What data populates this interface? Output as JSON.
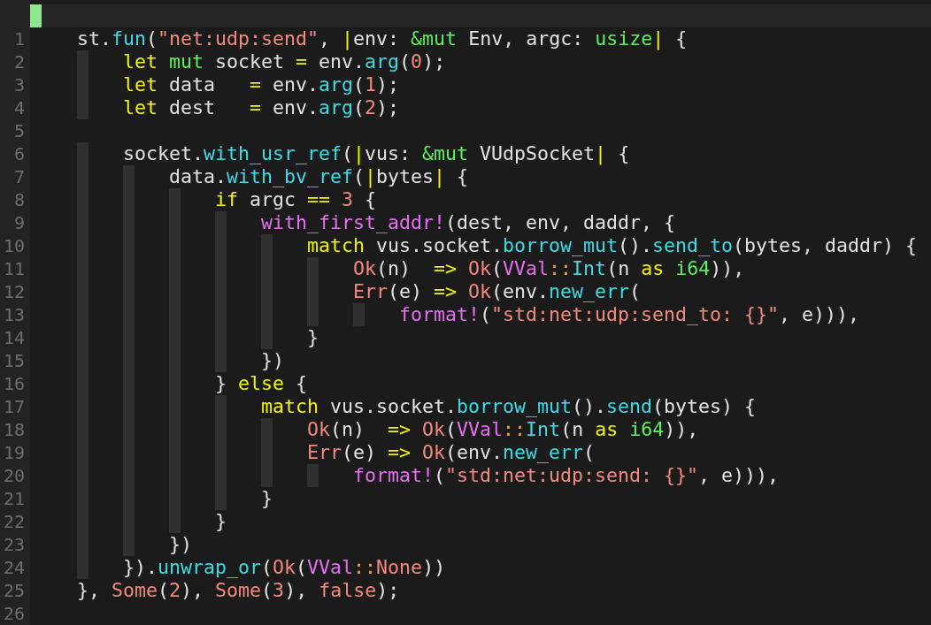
{
  "editor": {
    "lines": [
      {
        "number": "1",
        "tokens": [
          {
            "text": "    st.",
            "kind": "p"
          },
          {
            "text": "fun",
            "kind": "f"
          },
          {
            "text": "(",
            "kind": "p"
          },
          {
            "text": "\"net:udp:send\"",
            "kind": "s"
          },
          {
            "text": ", ",
            "kind": "p"
          },
          {
            "text": "|",
            "kind": "k"
          },
          {
            "text": "env: ",
            "kind": "p"
          },
          {
            "text": "&mut",
            "kind": "t"
          },
          {
            "text": " Env, argc: ",
            "kind": "p"
          },
          {
            "text": "usize",
            "kind": "t"
          },
          {
            "text": "|",
            "kind": "k"
          },
          {
            "text": " {",
            "kind": "p"
          }
        ]
      },
      {
        "number": "2",
        "tokens": [
          {
            "text": "        let ",
            "kind": "k"
          },
          {
            "text": "mut",
            "kind": "t"
          },
          {
            "text": " socket ",
            "kind": "p"
          },
          {
            "text": "=",
            "kind": "k"
          },
          {
            "text": " env.",
            "kind": "p"
          },
          {
            "text": "arg",
            "kind": "f"
          },
          {
            "text": "(",
            "kind": "p"
          },
          {
            "text": "0",
            "kind": "s"
          },
          {
            "text": ");",
            "kind": "p"
          }
        ]
      },
      {
        "number": "3",
        "tokens": [
          {
            "text": "        let",
            "kind": "k"
          },
          {
            "text": " data   ",
            "kind": "p"
          },
          {
            "text": "=",
            "kind": "k"
          },
          {
            "text": " env.",
            "kind": "p"
          },
          {
            "text": "arg",
            "kind": "f"
          },
          {
            "text": "(",
            "kind": "p"
          },
          {
            "text": "1",
            "kind": "s"
          },
          {
            "text": ");",
            "kind": "p"
          }
        ]
      },
      {
        "number": "4",
        "tokens": [
          {
            "text": "        let",
            "kind": "k"
          },
          {
            "text": " dest   ",
            "kind": "p"
          },
          {
            "text": "=",
            "kind": "k"
          },
          {
            "text": " env.",
            "kind": "p"
          },
          {
            "text": "arg",
            "kind": "f"
          },
          {
            "text": "(",
            "kind": "p"
          },
          {
            "text": "2",
            "kind": "s"
          },
          {
            "text": ");",
            "kind": "p"
          }
        ]
      },
      {
        "number": "5"
      },
      {
        "number": "6",
        "tokens": [
          {
            "text": "        socket.",
            "kind": "p"
          },
          {
            "text": "with_usr_ref",
            "kind": "f"
          },
          {
            "text": "(",
            "kind": "p"
          },
          {
            "text": "|",
            "kind": "k"
          },
          {
            "text": "vus: ",
            "kind": "p"
          },
          {
            "text": "&mut",
            "kind": "t"
          },
          {
            "text": " VUdpSocket",
            "kind": "p"
          },
          {
            "text": "|",
            "kind": "k"
          },
          {
            "text": " {",
            "kind": "p"
          }
        ]
      },
      {
        "number": "7",
        "tokens": [
          {
            "text": "            data.",
            "kind": "p"
          },
          {
            "text": "with_bv_ref",
            "kind": "f"
          },
          {
            "text": "(",
            "kind": "p"
          },
          {
            "text": "|",
            "kind": "k"
          },
          {
            "text": "bytes",
            "kind": "p"
          },
          {
            "text": "|",
            "kind": "k"
          },
          {
            "text": " {",
            "kind": "p"
          }
        ]
      },
      {
        "number": "8",
        "tokens": [
          {
            "text": "                if",
            "kind": "k"
          },
          {
            "text": " argc ",
            "kind": "p"
          },
          {
            "text": "== ",
            "kind": "k"
          },
          {
            "text": "3",
            "kind": "s"
          },
          {
            "text": " {",
            "kind": "p"
          }
        ]
      },
      {
        "number": "9",
        "tokens": [
          {
            "text": "                    with_first_addr!",
            "kind": "m"
          },
          {
            "text": "(dest, env, daddr, {",
            "kind": "p"
          }
        ]
      },
      {
        "number": "10",
        "tokens": [
          {
            "text": "                        match",
            "kind": "k"
          },
          {
            "text": " vus.socket.",
            "kind": "p"
          },
          {
            "text": "borrow_mut",
            "kind": "f"
          },
          {
            "text": "().",
            "kind": "p"
          },
          {
            "text": "send_to",
            "kind": "f"
          },
          {
            "text": "(bytes, daddr) {",
            "kind": "p"
          }
        ]
      },
      {
        "number": "11",
        "tokens": [
          {
            "text": "                            Ok",
            "kind": "s"
          },
          {
            "text": "(n)  ",
            "kind": "p"
          },
          {
            "text": "=> ",
            "kind": "k"
          },
          {
            "text": "Ok",
            "kind": "s"
          },
          {
            "text": "(",
            "kind": "p"
          },
          {
            "text": "VVal",
            "kind": "m"
          },
          {
            "text": "::",
            "kind": "o"
          },
          {
            "text": "Int",
            "kind": "f"
          },
          {
            "text": "(n ",
            "kind": "p"
          },
          {
            "text": "as ",
            "kind": "k"
          },
          {
            "text": "i64",
            "kind": "t"
          },
          {
            "text": ")),",
            "kind": "p"
          }
        ]
      },
      {
        "number": "12",
        "tokens": [
          {
            "text": "                            Err",
            "kind": "s"
          },
          {
            "text": "(e) ",
            "kind": "p"
          },
          {
            "text": "=> ",
            "kind": "k"
          },
          {
            "text": "Ok",
            "kind": "s"
          },
          {
            "text": "(env.",
            "kind": "p"
          },
          {
            "text": "new_err",
            "kind": "f"
          },
          {
            "text": "(",
            "kind": "p"
          }
        ]
      },
      {
        "number": "13",
        "tokens": [
          {
            "text": "                                format!",
            "kind": "m"
          },
          {
            "text": "(",
            "kind": "p"
          },
          {
            "text": "\"std:net:udp:send_to: {}\"",
            "kind": "s"
          },
          {
            "text": ", e))),",
            "kind": "p"
          }
        ]
      },
      {
        "number": "14",
        "tokens": [
          {
            "text": "                        }",
            "kind": "p"
          }
        ]
      },
      {
        "number": "15",
        "tokens": [
          {
            "text": "                    })",
            "kind": "p"
          }
        ]
      },
      {
        "number": "16",
        "tokens": [
          {
            "text": "                } ",
            "kind": "p"
          },
          {
            "text": "else",
            "kind": "k"
          },
          {
            "text": " {",
            "kind": "p"
          }
        ]
      },
      {
        "number": "17",
        "tokens": [
          {
            "text": "                    match",
            "kind": "k"
          },
          {
            "text": " vus.socket.",
            "kind": "p"
          },
          {
            "text": "borrow_mut",
            "kind": "f"
          },
          {
            "text": "().",
            "kind": "p"
          },
          {
            "text": "send",
            "kind": "f"
          },
          {
            "text": "(bytes) {",
            "kind": "p"
          }
        ]
      },
      {
        "number": "18",
        "tokens": [
          {
            "text": "                        Ok",
            "kind": "s"
          },
          {
            "text": "(n)  ",
            "kind": "p"
          },
          {
            "text": "=> ",
            "kind": "k"
          },
          {
            "text": "Ok",
            "kind": "s"
          },
          {
            "text": "(",
            "kind": "p"
          },
          {
            "text": "VVal",
            "kind": "m"
          },
          {
            "text": "::",
            "kind": "o"
          },
          {
            "text": "Int",
            "kind": "f"
          },
          {
            "text": "(n ",
            "kind": "p"
          },
          {
            "text": "as ",
            "kind": "k"
          },
          {
            "text": "i64",
            "kind": "t"
          },
          {
            "text": ")),",
            "kind": "p"
          }
        ]
      },
      {
        "number": "19",
        "tokens": [
          {
            "text": "                        Err",
            "kind": "s"
          },
          {
            "text": "(e) ",
            "kind": "p"
          },
          {
            "text": "=> ",
            "kind": "k"
          },
          {
            "text": "Ok",
            "kind": "s"
          },
          {
            "text": "(env.",
            "kind": "p"
          },
          {
            "text": "new_err",
            "kind": "f"
          },
          {
            "text": "(",
            "kind": "p"
          }
        ]
      },
      {
        "number": "20",
        "tokens": [
          {
            "text": "                            format!",
            "kind": "m"
          },
          {
            "text": "(",
            "kind": "p"
          },
          {
            "text": "\"std:net:udp:send: {}\"",
            "kind": "s"
          },
          {
            "text": ", e))),",
            "kind": "p"
          }
        ]
      },
      {
        "number": "21",
        "tokens": [
          {
            "text": "                    }",
            "kind": "p"
          }
        ]
      },
      {
        "number": "22",
        "tokens": [
          {
            "text": "                }",
            "kind": "p"
          }
        ]
      },
      {
        "number": "23",
        "tokens": [
          {
            "text": "            })",
            "kind": "p"
          }
        ]
      },
      {
        "number": "24",
        "tokens": [
          {
            "text": "        }).",
            "kind": "p"
          },
          {
            "text": "unwrap_or",
            "kind": "f"
          },
          {
            "text": "(",
            "kind": "p"
          },
          {
            "text": "Ok",
            "kind": "s"
          },
          {
            "text": "(",
            "kind": "p"
          },
          {
            "text": "VVal",
            "kind": "m"
          },
          {
            "text": "::",
            "kind": "o"
          },
          {
            "text": "None",
            "kind": "s"
          },
          {
            "text": "))",
            "kind": "p"
          }
        ]
      },
      {
        "number": "25",
        "tokens": [
          {
            "text": "    }, ",
            "kind": "p"
          },
          {
            "text": "Some",
            "kind": "s"
          },
          {
            "text": "(",
            "kind": "p"
          },
          {
            "text": "2",
            "kind": "s"
          },
          {
            "text": "), ",
            "kind": "p"
          },
          {
            "text": "Some",
            "kind": "s"
          },
          {
            "text": "(",
            "kind": "p"
          },
          {
            "text": "3",
            "kind": "s"
          },
          {
            "text": "), ",
            "kind": "p"
          },
          {
            "text": "false",
            "kind": "s"
          },
          {
            "text": ");",
            "kind": "p"
          }
        ]
      },
      {
        "number": "26"
      }
    ]
  }
}
